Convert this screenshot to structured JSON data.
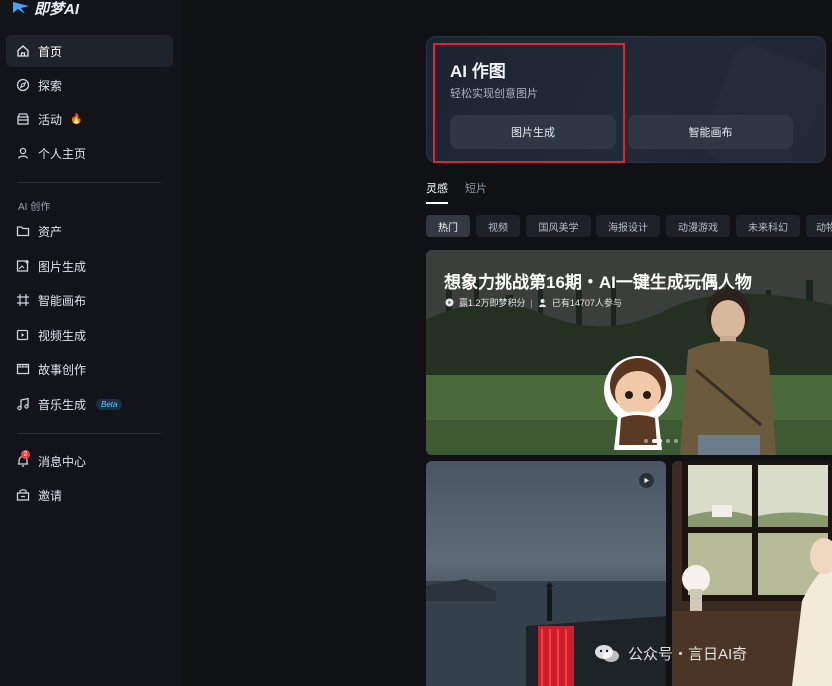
{
  "app": {
    "logo_text": "即梦AI"
  },
  "sidebar": {
    "items": [
      {
        "label": "首页",
        "icon": "home-icon"
      },
      {
        "label": "探索",
        "icon": "compass-icon"
      },
      {
        "label": "活动",
        "icon": "gift-icon",
        "fire": "🔥"
      },
      {
        "label": "个人主页",
        "icon": "user-icon"
      }
    ],
    "section_label": "AI 创作",
    "create_items": [
      {
        "label": "资产",
        "icon": "folder-icon"
      },
      {
        "label": "图片生成",
        "icon": "image-plus-icon"
      },
      {
        "label": "智能画布",
        "icon": "canvas-icon"
      },
      {
        "label": "视频生成",
        "icon": "video-plus-icon"
      },
      {
        "label": "故事创作",
        "icon": "film-icon"
      },
      {
        "label": "音乐生成",
        "icon": "music-icon",
        "beta": "Beta"
      }
    ],
    "bottom_items": [
      {
        "label": "消息中心",
        "icon": "bell-icon",
        "badge": "2"
      },
      {
        "label": "邀请",
        "icon": "invite-icon"
      }
    ]
  },
  "hero": {
    "title": "AI 作图",
    "subtitle": "轻松实现创意图片",
    "btn_image": "图片生成",
    "btn_canvas": "智能画布"
  },
  "tabs": [
    "灵感",
    "短片"
  ],
  "chips": [
    "热门",
    "视频",
    "国风美学",
    "海报设计",
    "动漫游戏",
    "未来科幻",
    "动物"
  ],
  "banner": {
    "title": "想象力挑战第16期・AI一键生成玩偶人物",
    "reward": "赢1.2万即梦积分",
    "participants": "已有14707人参与"
  },
  "watermark": "公众号・言日AI奇"
}
